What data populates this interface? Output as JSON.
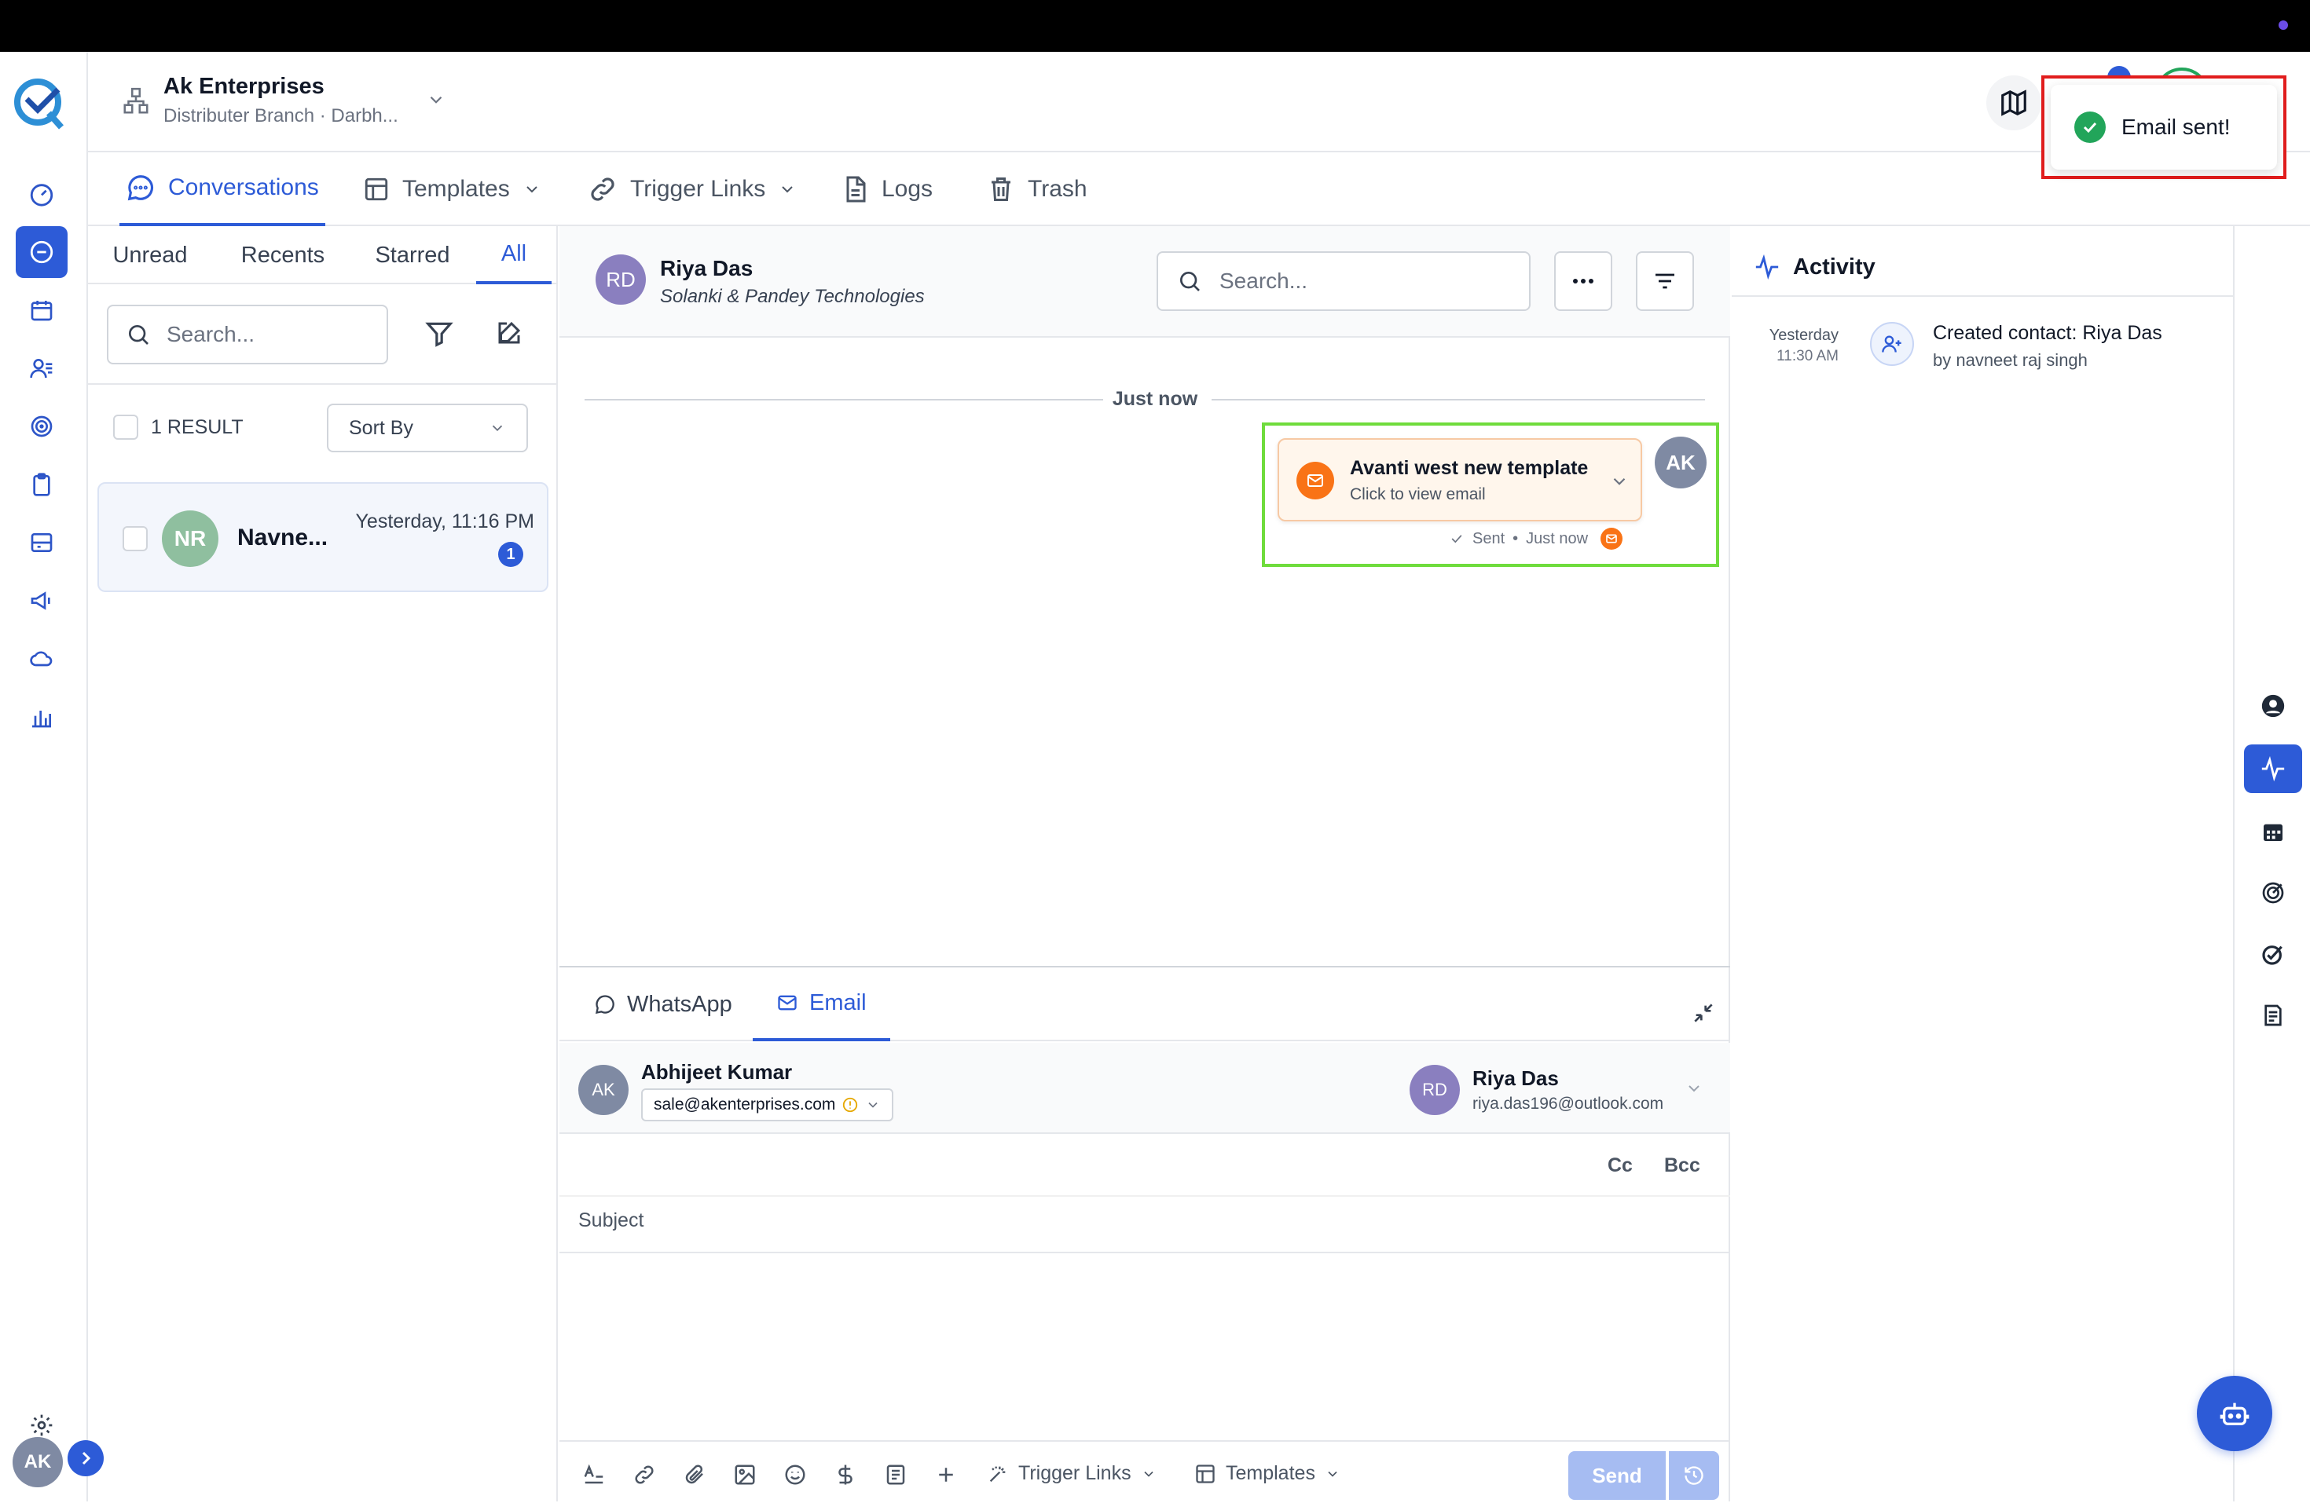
{
  "company": {
    "name": "Ak Enterprises",
    "branch": "Distributer Branch · Darbh..."
  },
  "toast": {
    "message": "Email sent!"
  },
  "nav_tabs": [
    {
      "label": "Conversations",
      "icon": "chat-bubble-icon"
    },
    {
      "label": "Templates",
      "icon": "template-icon"
    },
    {
      "label": "Trigger Links",
      "icon": "link-icon"
    },
    {
      "label": "Logs",
      "icon": "document-icon"
    },
    {
      "label": "Trash",
      "icon": "trash-icon"
    }
  ],
  "list": {
    "filters": [
      "Unread",
      "Recents",
      "Starred",
      "All"
    ],
    "active_filter": "All",
    "search_placeholder": "Search...",
    "result_count": "1 RESULT",
    "sort_label": "Sort By",
    "items": [
      {
        "initials": "NR",
        "name": "Navne...",
        "time": "Yesterday, 11:16 PM",
        "unread": "1"
      }
    ]
  },
  "chat": {
    "contact_initials": "RD",
    "contact_name": "Riya Das",
    "contact_company": "Solanki & Pandey Technologies",
    "search_placeholder": "Search...",
    "divider": "Just now",
    "message": {
      "title": "Avanti west new template",
      "subtitle": "Click to view email",
      "status": "Sent",
      "time": "Just now",
      "sender_initials": "AK"
    }
  },
  "composer": {
    "tabs": [
      "WhatsApp",
      "Email"
    ],
    "active_tab": "Email",
    "from_initials": "AK",
    "from_name": "Abhijeet Kumar",
    "from_email": "sale@akenterprises.com",
    "to_initials": "RD",
    "to_name": "Riya Das",
    "to_email": "riya.das196@outlook.com",
    "cc": "Cc",
    "bcc": "Bcc",
    "subject_placeholder": "Subject",
    "trigger_links": "Trigger Links",
    "templates": "Templates",
    "send": "Send"
  },
  "activity": {
    "title": "Activity",
    "items": [
      {
        "date": "Yesterday",
        "time": "11:30 AM",
        "text": "Created contact: Riya Das",
        "by": "by navneet raj singh"
      }
    ]
  },
  "user": {
    "initials": "AK"
  },
  "colors": {
    "accent": "#2d5bd7",
    "email_orange": "#f97316",
    "success": "#22a55a"
  }
}
